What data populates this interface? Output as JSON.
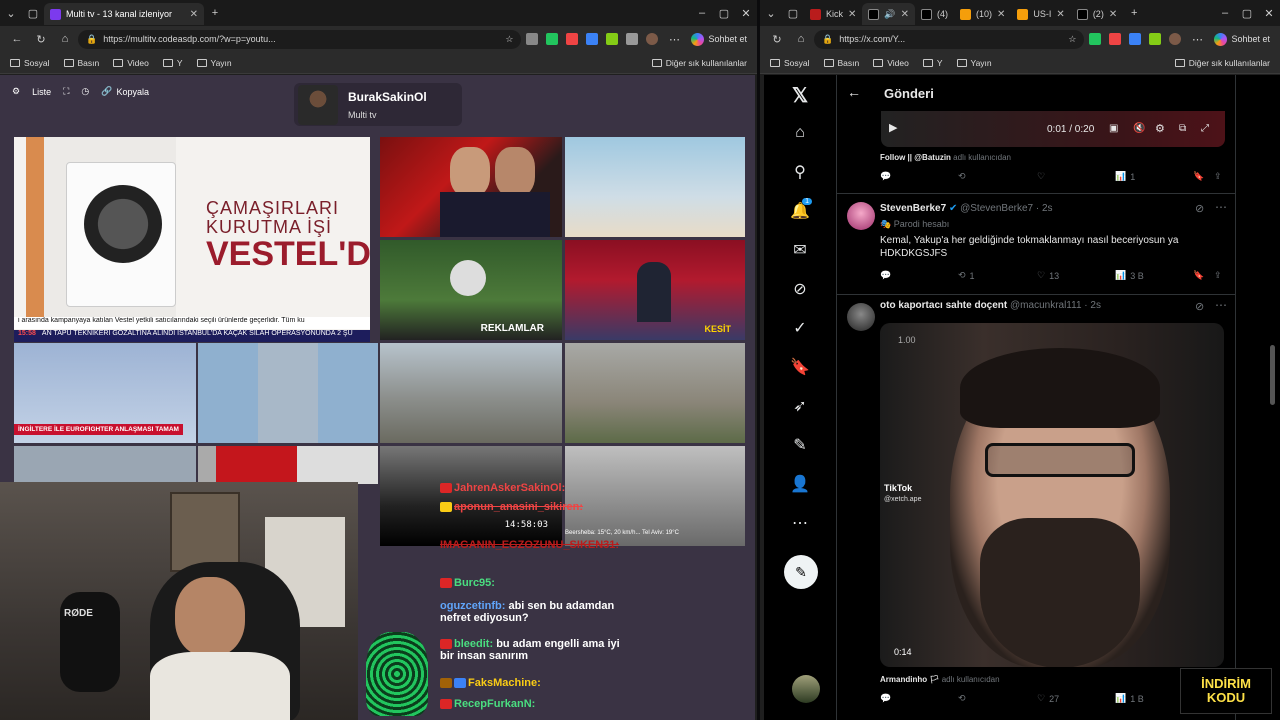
{
  "left_window": {
    "tab_title": "Multi tv - 13 kanal izleniyor",
    "url": "https://multitv.codeasdp.com/?w=p=youtu...",
    "copilot_label": "Sohbet et",
    "bookmarks": [
      "Sosyal",
      "Basın",
      "Video",
      "Y",
      "Yayın"
    ],
    "bookmarks_right": "Diğer sık kullanılanlar"
  },
  "right_window": {
    "tabs": [
      "Kick",
      "(4)",
      "(10)",
      "US-I",
      "(2)"
    ],
    "url": "https://x.com/Y...",
    "copilot_label": "Sohbet et",
    "bookmarks": [
      "Sosyal",
      "Basın",
      "Video",
      "Y",
      "Yayın"
    ],
    "bookmarks_right": "Diğer sık kullanılanlar"
  },
  "multitv": {
    "toolbar": {
      "list": "Liste",
      "copy": "Kopyala"
    },
    "profile": {
      "name": "BurakSakinOl",
      "subtitle": "Multi tv"
    },
    "ad": {
      "line1": "ÇAMAŞIRLARI",
      "line2": "KURUTMA İŞİ",
      "line3": "VESTEL'DE!",
      "ticker": "i arasında kampanyaya katılan Vestel yetkili satıcılarındaki seçili ürünlerde geçerlidir. Tüm ku",
      "ticker2_time": "15:58",
      "ticker2": "AN TAPU TEKNİKERİ GÖZALTINA ALINDI   İSTANBUL'DA KAÇAK SİLAH OPERASYONUNDA 2 ŞÜ"
    },
    "tile_labels": {
      "reklamlar": "REKLAMLAR",
      "kesit": "KESİT",
      "eurofighter": "İNGİLTERE İLE EUROFIGHTER ANLAŞMASI TAMAM",
      "clock": "14:58:03",
      "weather": "Beersheba: 15°C, 20 km/h... Tel Aviv: 19°C"
    }
  },
  "chat": {
    "messages": [
      {
        "user": "JahrenAskerSakinOl:",
        "text": "",
        "color": "#ef4444"
      },
      {
        "user": "aponun_anasini_sikiren:",
        "text": "",
        "color": "#ef4444"
      },
      {
        "user": "IMAGANIN_EGZOZUNU_SIKEN31:",
        "text": "",
        "color": "#b91c1c"
      },
      {
        "user": "Burc95:",
        "text": "",
        "color": "#4ade80"
      },
      {
        "user": "oguzcetinfb:",
        "text": "abi sen bu adamdan",
        "text2": "nefret ediyosun?",
        "color": "#60a5fa"
      },
      {
        "user": "bleedit:",
        "text": "bu adam engelli ama iyi",
        "text2": "bir insan sanırım",
        "color": "#4ade80"
      },
      {
        "user": "FaksMachine:",
        "text": "",
        "color": "#facc15"
      },
      {
        "user": "RecepFurkanN:",
        "text": "",
        "color": "#4ade80"
      }
    ]
  },
  "x": {
    "header": "Gönderi",
    "video_time": "0:01 / 0:20",
    "follow_line": "Follow || @Batuzin",
    "follow_suffix": "adlı kullanıcıdan",
    "first_stats": {
      "views": "1"
    },
    "post1": {
      "name": "StevenBerke7",
      "handle": "@StevenBerke7 · 2s",
      "parody": "Parodi hesabı",
      "text_line1": "Kemal, Yakup'a her geldiğinde tokmaklanmayı nasıl beceriyosun ya",
      "text_line2": "HDKDKGSJFS",
      "retweets": "1",
      "likes": "13",
      "views": "3 B"
    },
    "post2": {
      "name": "oto kaportacı sahte doçent",
      "handle": "@macunkral111 · 2s",
      "video_speed": "1.00",
      "video_time": "0:14",
      "tiktok": "TikTok",
      "tiktok_user": "@xetch.ape",
      "credit_name": "Armandinho",
      "credit_suffix": "adlı kullanıcıdan",
      "likes": "27",
      "views": "1 B"
    },
    "notification_count": "1"
  },
  "overlay": {
    "line1": "İNDİRİM",
    "line2": "KODU"
  }
}
